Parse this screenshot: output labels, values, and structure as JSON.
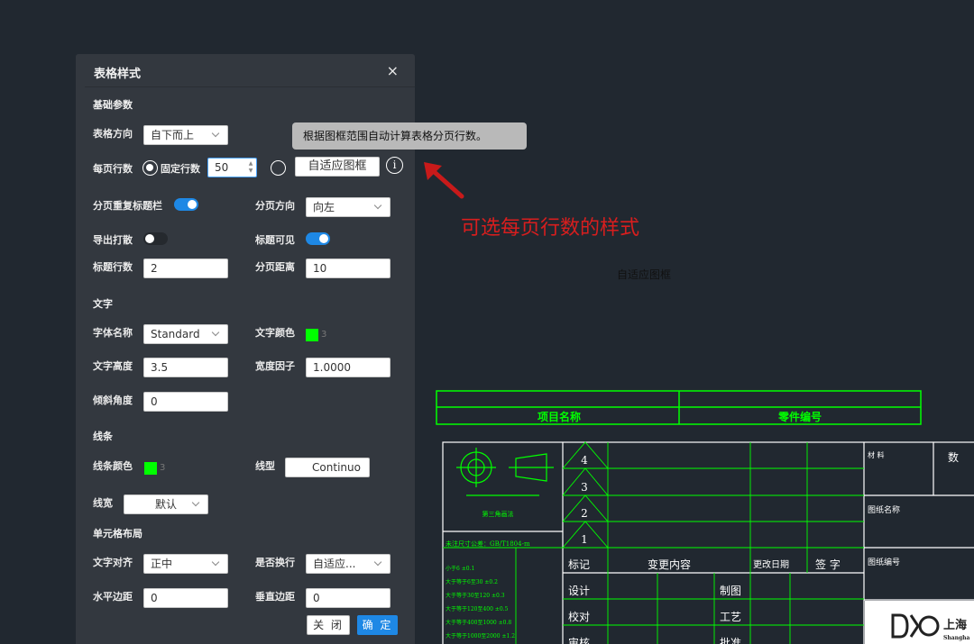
{
  "dialog": {
    "title": "表格样式",
    "close": "×",
    "sections": {
      "basic": "基础参数",
      "text": "文字",
      "lines": "线条",
      "cell_layout": "单元格布局"
    },
    "basic": {
      "direction_label": "表格方向",
      "direction_value": "自下而上",
      "rows_per_page_label": "每页行数",
      "fixed_rows_label": "固定行数",
      "fixed_rows_value": "50",
      "adaptive_label": "自适应图框",
      "repeat_header_label": "分页重复标题栏",
      "repeat_header_on": true,
      "page_direction_label": "分页方向",
      "page_direction_value": "向左",
      "export_print_label": "导出打散",
      "export_print_on": false,
      "title_visible_label": "标题可见",
      "title_visible_on": true,
      "title_rows_label": "标题行数",
      "title_rows_value": "2",
      "page_distance_label": "分页距离",
      "page_distance_value": "10"
    },
    "text": {
      "font_name_label": "字体名称",
      "font_name_value": "Standard",
      "text_color_label": "文字颜色",
      "text_color_index": "3",
      "text_height_label": "文字高度",
      "text_height_value": "3.5",
      "width_factor_label": "宽度因子",
      "width_factor_value": "1.0000",
      "slant_label": "倾斜角度",
      "slant_value": "0"
    },
    "lines": {
      "line_color_label": "线条颜色",
      "line_color_index": "3",
      "line_type_label": "线型",
      "line_type_value": "Continuo",
      "line_width_label": "线宽",
      "line_width_value": "默认"
    },
    "cell_layout": {
      "text_align_label": "文字对齐",
      "text_align_value": "正中",
      "wrap_label": "是否换行",
      "wrap_value": "自适应...",
      "h_margin_label": "水平边距",
      "h_margin_value": "0",
      "v_margin_label": "垂直边距",
      "v_margin_value": "0"
    },
    "buttons": {
      "close": "关 闭",
      "ok": "确 定"
    }
  },
  "tooltip": "根据图框范围自动计算表格分页行数。",
  "info_icon": "i",
  "annotation": "可选每页行数的样式",
  "canvas_label": "自适应图框",
  "cad": {
    "header_cells": [
      "项目名称",
      "零件编号"
    ],
    "row_numbers": [
      "4",
      "3",
      "2",
      "1"
    ],
    "row_headers": [
      "标记",
      "变更内容",
      "更改日期",
      "签 字"
    ],
    "sign_rows": [
      "设计",
      "校对",
      "审核"
    ],
    "sign_cols": [
      "制图",
      "工艺",
      "批准"
    ],
    "right_labels": [
      "材 料",
      "数",
      "图纸名称",
      "图纸编号"
    ],
    "small_caption": "第三角画法",
    "tolerance_title": "未注尺寸公差：GB/T1804-m",
    "tolerances": [
      "小于6 ±0.1",
      "大于等于6至30 ±0.2",
      "大于等于30至120 ±0.3",
      "大于等于120至400 ±0.5",
      "大于等于400至1000 ±0.8",
      "大于等于1000至2000 ±1.2"
    ],
    "logo_text": "上海",
    "logo_sub": "Shangha"
  },
  "colors": {
    "accent": "#1e88e5",
    "cad_line": "#00ff00",
    "annotation": "#d81e1e",
    "dialog_bg": "#33383f",
    "canvas_bg": "#212830"
  }
}
